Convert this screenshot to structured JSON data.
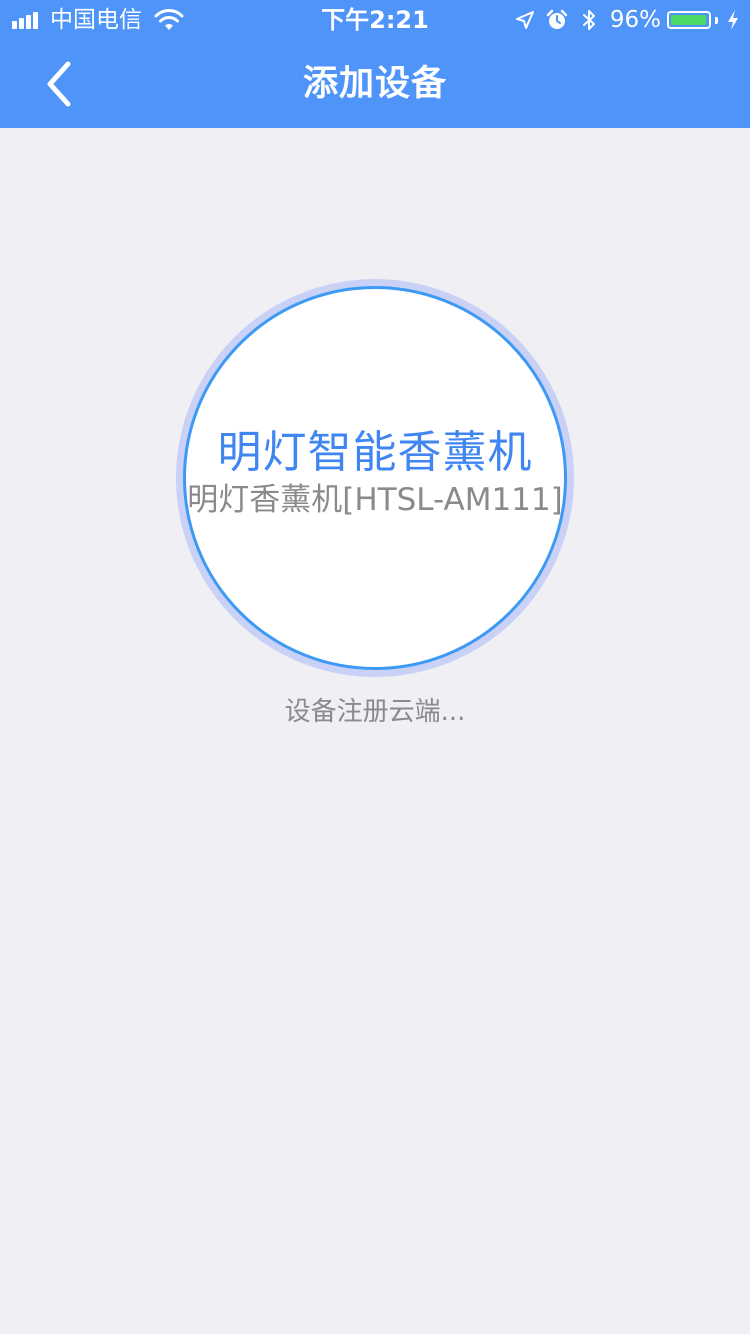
{
  "status_bar": {
    "carrier": "中国电信",
    "time": "下午2:21",
    "battery_percent_label": "96%",
    "battery_level": 0.96,
    "battery_fill_color": "#4cd964",
    "icons": [
      "signal-icon",
      "wifi-icon",
      "location-arrow-icon",
      "alarm-icon",
      "bluetooth-icon",
      "battery-icon",
      "charging-icon"
    ]
  },
  "navbar": {
    "title": "添加设备",
    "back_icon": "chevron-left-icon",
    "background_color": "#4f94f8"
  },
  "device": {
    "name": "明灯智能香薰机",
    "model": "明灯香薰机[HTSL-AM111]",
    "name_color": "#3f86f2",
    "ring_color": "#3c9af5"
  },
  "progress": {
    "status_text": "设备注册云端..."
  }
}
